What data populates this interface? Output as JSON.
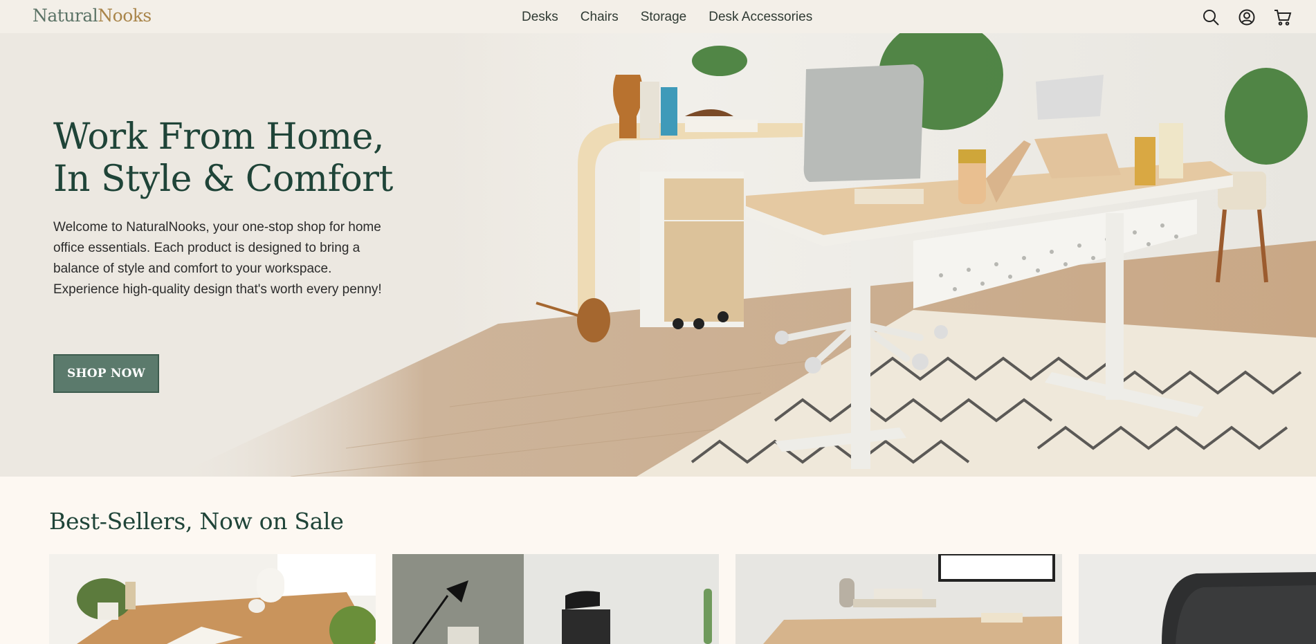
{
  "header": {
    "logo_part1": "Natural",
    "logo_part2": "Nooks",
    "nav": [
      "Desks",
      "Chairs",
      "Storage",
      "Desk Accessories"
    ],
    "icons": [
      "search-icon",
      "account-icon",
      "cart-icon"
    ]
  },
  "hero": {
    "title_line1": "Work From Home,",
    "title_line2": "In Style & Comfort",
    "description": "Welcome to NaturalNooks, your one-stop shop for home office essentials. Each product is designed to bring a balance of style and comfort to your workspace. Experience high-quality design that's worth every penny!",
    "cta_label": "SHOP NOW"
  },
  "best_sellers": {
    "title": "Best-Sellers, Now on Sale"
  },
  "colors": {
    "brand_green": "#1f4438",
    "button_green": "#5b7a6c",
    "logo_gold": "#a9854a",
    "header_bg": "#f3efe8",
    "page_bg": "#fdf8f2"
  }
}
